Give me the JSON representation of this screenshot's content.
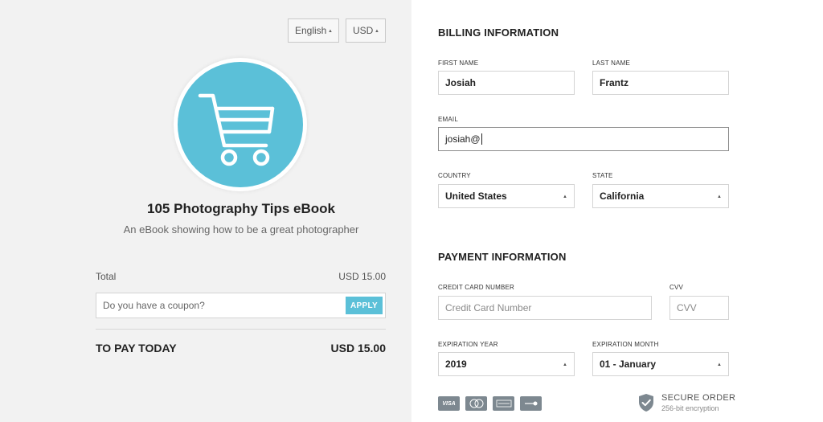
{
  "header": {
    "language": "English",
    "currency": "USD"
  },
  "product": {
    "title": "105 Photography Tips eBook",
    "subtitle": "An eBook showing how to be a great photographer"
  },
  "summary": {
    "total_label": "Total",
    "total_value": "USD 15.00",
    "coupon_placeholder": "Do you have a coupon?",
    "apply_label": "APPLY",
    "pay_label": "TO PAY TODAY",
    "pay_value": "USD 15.00"
  },
  "billing": {
    "title": "BILLING INFORMATION",
    "first_name_label": "FIRST NAME",
    "first_name": "Josiah",
    "last_name_label": "LAST NAME",
    "last_name": "Frantz",
    "email_label": "EMAIL",
    "email": "josiah@",
    "country_label": "COUNTRY",
    "country": "United States",
    "state_label": "STATE",
    "state": "California"
  },
  "payment": {
    "title": "PAYMENT INFORMATION",
    "cc_label": "CREDIT CARD NUMBER",
    "cc_placeholder": "Credit Card Number",
    "cvv_label": "CVV",
    "cvv_placeholder": "CVV",
    "exp_year_label": "EXPIRATION YEAR",
    "exp_year": "2019",
    "exp_month_label": "EXPIRATION MONTH",
    "exp_month": "01 - January",
    "cards": [
      "VISA",
      "mastercard",
      "AMERICAN EXPRESS",
      "DISCOVER"
    ]
  },
  "secure": {
    "title": "SECURE ORDER",
    "subtitle": "256-bit encryption"
  },
  "colors": {
    "accent": "#5bc0d8",
    "left_bg": "#f2f2f2"
  },
  "icons": [
    "cart-icon",
    "shield-check-icon",
    "dropdown-arrow-icon"
  ]
}
